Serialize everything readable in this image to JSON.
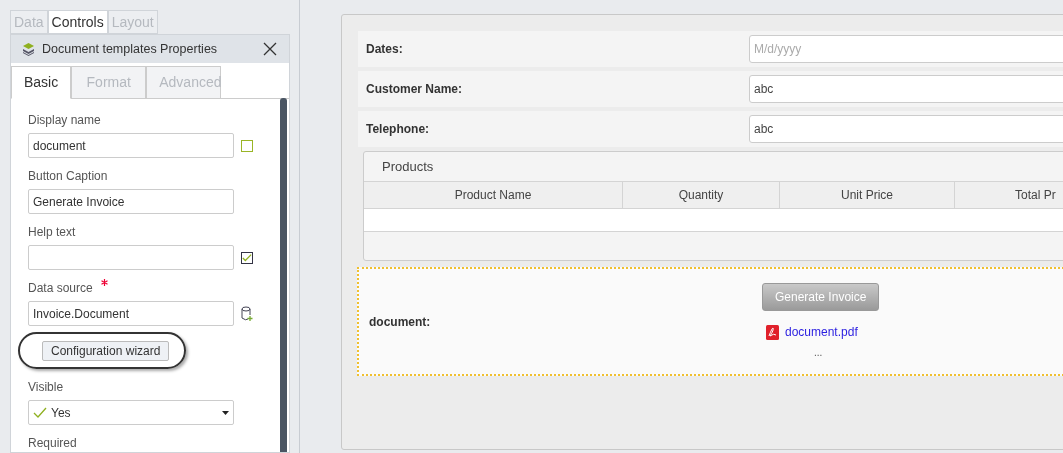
{
  "outer_tabs": [
    {
      "label": "Data",
      "selected": false
    },
    {
      "label": "Controls",
      "selected": true
    },
    {
      "label": "Layout",
      "selected": false
    }
  ],
  "panel": {
    "title": "Document templates Properties",
    "tabs": [
      {
        "label": "Basic",
        "selected": true
      },
      {
        "label": "Format",
        "selected": false
      },
      {
        "label": "Advanced",
        "selected": false
      }
    ],
    "fields": [
      {
        "kind": "check",
        "label": "Display name",
        "value": "document",
        "checked": false
      },
      {
        "kind": "check",
        "label": "Button Caption",
        "value": "Generate Invoice"
      },
      {
        "kind": "check",
        "label": "Help text",
        "checked": true
      },
      {
        "kind": "database",
        "label": "Data source",
        "value": "Invoice.Document",
        "required": true
      },
      {
        "kind": "button",
        "label": "Configuration wizard",
        "circled": true
      },
      {
        "kind": "select",
        "label": "Visible",
        "value": "Yes"
      },
      {
        "kind": "select",
        "label": "Required"
      }
    ]
  },
  "form": {
    "rows": [
      {
        "label": "Dates:",
        "placeholder": "M/d/yyyy"
      },
      {
        "label": "Customer Name:",
        "value": "abc"
      },
      {
        "label": "Telephone:",
        "value": "abc"
      }
    ],
    "products": {
      "title": "Products",
      "columns": [
        "Product Name",
        "Quantity",
        "Unit Price",
        "Total Pr"
      ]
    },
    "document": {
      "label": "document:",
      "button": "Generate Invoice",
      "file": "document.pdf",
      "ellipsis": "..."
    }
  }
}
